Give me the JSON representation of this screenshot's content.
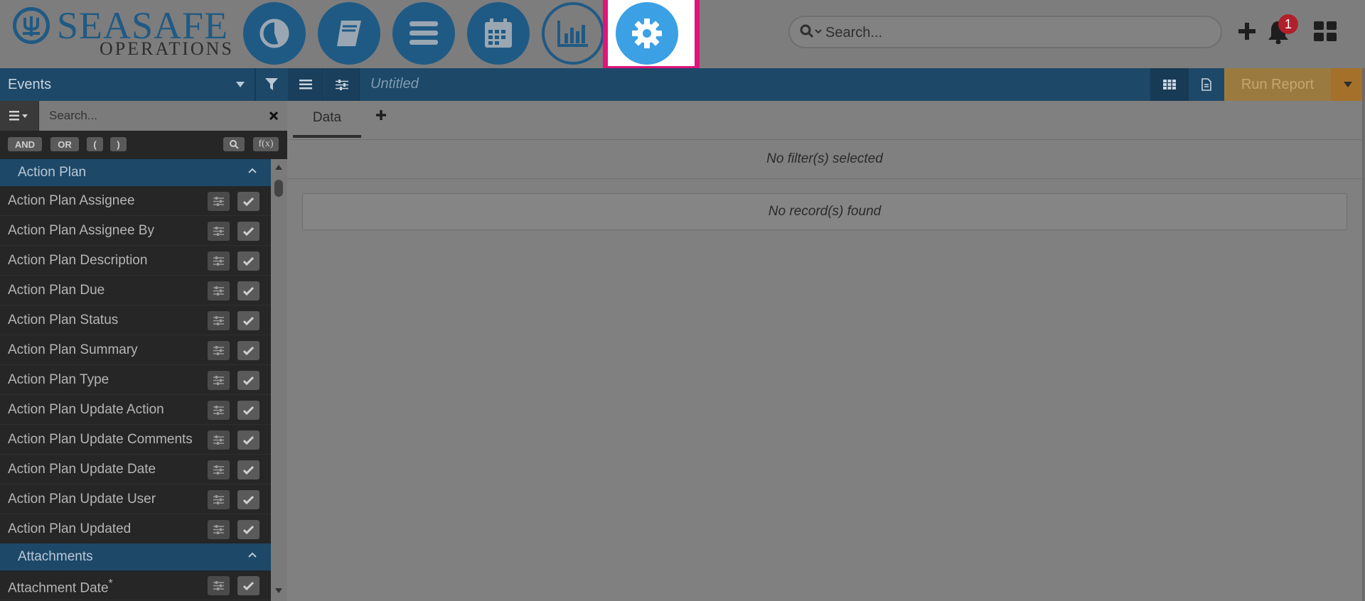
{
  "brand": {
    "name_top": "SEASAFE",
    "name_bottom": "OPERATIONS"
  },
  "nav": {
    "icons": [
      "pie-chart-icon",
      "book-icon",
      "list-icon",
      "calendar-icon",
      "bar-chart-icon",
      "gear-icon"
    ],
    "highlight_color": "#e0147a",
    "active_color": "#3ba0e4"
  },
  "search": {
    "placeholder": "Search..."
  },
  "notifications": {
    "count": "1"
  },
  "left_panel": {
    "module": "Events",
    "search_placeholder": "Search...",
    "operators": [
      "AND",
      "OR",
      "(",
      ")"
    ],
    "function_label": "f(x)",
    "groups": [
      {
        "label": "Action Plan",
        "fields": [
          "Action Plan Assignee",
          "Action Plan Assignee By",
          "Action Plan Description",
          "Action Plan Due",
          "Action Plan Status",
          "Action Plan Summary",
          "Action Plan Type",
          "Action Plan Update Action",
          "Action Plan Update Comments",
          "Action Plan Update Date",
          "Action Plan Update User",
          "Action Plan Updated"
        ]
      },
      {
        "label": "Attachments",
        "fields": [
          "Attachment Date"
        ]
      }
    ],
    "required_mark": "*"
  },
  "report": {
    "title": "Untitled",
    "run_label": "Run Report",
    "tabs": [
      "Data"
    ],
    "no_filters": "No filter(s) selected",
    "no_records": "No record(s) found"
  }
}
